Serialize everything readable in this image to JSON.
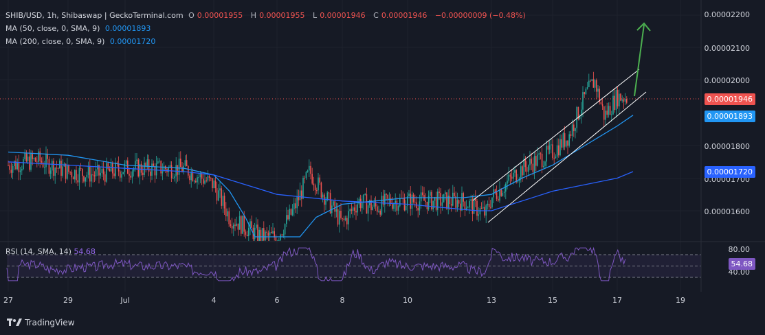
{
  "header": {
    "symbol": "SHIB/USD, 1h, Shibaswap | GeckoTerminal.com",
    "o_label": "O",
    "o_value": "0.00001955",
    "h_label": "H",
    "h_value": "0.00001955",
    "l_label": "L",
    "l_value": "0.00001946",
    "c_label": "C",
    "c_value": "0.00001946",
    "change": "−0.00000009 (−0.48%)"
  },
  "indicators": {
    "ma50_label": "MA (50, close, 0, SMA, 9)",
    "ma50_value": "0.00001893",
    "ma200_label": "MA (200, close, 0, SMA, 9)",
    "ma200_value": "0.00001720",
    "rsi_label": "RSI (14, SMA, 14)",
    "rsi_value": "54.68"
  },
  "price_tags": {
    "last": "0.00001946",
    "ma50": "0.00001893",
    "ma200": "0.00001720",
    "rsi": "54.68"
  },
  "colors": {
    "background": "#161a25",
    "up": "#26a69a",
    "down": "#ef5350",
    "ma50": "#2196f3",
    "ma200": "#2962ff",
    "rsi": "#7e57c2",
    "arrow": "#4caf50",
    "channel": "#ffffff"
  },
  "brand": "TradingView",
  "chart_data": {
    "type": "candlestick",
    "title": "SHIB/USD, 1h, Shibaswap | GeckoTerminal.com",
    "y_ticks": [
      "0.00002200",
      "0.00002100",
      "0.00002000",
      "0.00001800",
      "0.00001700",
      "0.00001600"
    ],
    "y_range": [
      1.58e-05,
      2.22e-05
    ],
    "x_ticks": [
      "27",
      "29",
      "Jul",
      "4",
      "6",
      "8",
      "10",
      "13",
      "15",
      "17",
      "19"
    ],
    "rsi_ticks": [
      "80.00",
      "40.00"
    ],
    "rsi_range": [
      20,
      90
    ],
    "rsi_bands": [
      70,
      50,
      30
    ],
    "price_anchors": [
      [
        "27",
        1.74e-05
      ],
      [
        "28",
        1.755e-05
      ],
      [
        "29",
        1.72e-05
      ],
      [
        "30",
        1.71e-05
      ],
      [
        "Jul",
        1.73e-05
      ],
      [
        "2",
        1.73e-05
      ],
      [
        "3",
        1.73e-05
      ],
      [
        "4",
        1.68e-05
      ],
      [
        "4.5",
        1.58e-05
      ],
      [
        "5",
        1.55e-05
      ],
      [
        "5.5",
        1.52e-05
      ],
      [
        "6",
        1.52e-05
      ],
      [
        "6.5",
        1.6e-05
      ],
      [
        "7",
        1.72e-05
      ],
      [
        "7.5",
        1.64e-05
      ],
      [
        "8",
        1.56e-05
      ],
      [
        "8.5",
        1.63e-05
      ],
      [
        "9",
        1.61e-05
      ],
      [
        "9.5",
        1.63e-05
      ],
      [
        "10",
        1.63e-05
      ],
      [
        "11",
        1.63e-05
      ],
      [
        "12",
        1.63e-05
      ],
      [
        "12.8",
        1.59e-05
      ],
      [
        "13",
        1.64e-05
      ],
      [
        "14",
        1.73e-05
      ],
      [
        "15",
        1.78e-05
      ],
      [
        "15.5",
        1.83e-05
      ],
      [
        "16",
        1.95e-05
      ],
      [
        "16.3",
        2e-05
      ],
      [
        "16.6",
        1.89e-05
      ],
      [
        "17",
        1.95e-05
      ],
      [
        "17.5",
        1.946e-05
      ]
    ],
    "ma50": [
      [
        "27",
        1.78e-05
      ],
      [
        "29",
        1.77e-05
      ],
      [
        "Jul",
        1.74e-05
      ],
      [
        "3",
        1.73e-05
      ],
      [
        "4",
        1.71e-05
      ],
      [
        "4.5",
        1.66e-05
      ],
      [
        "5",
        1.58e-05
      ],
      [
        "5.3",
        1.52e-05
      ],
      [
        "6.7",
        1.52e-05
      ],
      [
        "7.2",
        1.58e-05
      ],
      [
        "8",
        1.62e-05
      ],
      [
        "9",
        1.63e-05
      ],
      [
        "10",
        1.64e-05
      ],
      [
        "12",
        1.64e-05
      ],
      [
        "13",
        1.65e-05
      ],
      [
        "14",
        1.7e-05
      ],
      [
        "15",
        1.74e-05
      ],
      [
        "16",
        1.8e-05
      ],
      [
        "17",
        1.86e-05
      ],
      [
        "17.5",
        1.893e-05
      ]
    ],
    "ma200": [
      [
        "27",
        1.75e-05
      ],
      [
        "29",
        1.74e-05
      ],
      [
        "Jul",
        1.73e-05
      ],
      [
        "3",
        1.72e-05
      ],
      [
        "4",
        1.71e-05
      ],
      [
        "5",
        1.68e-05
      ],
      [
        "6",
        1.65e-05
      ],
      [
        "7",
        1.64e-05
      ],
      [
        "8",
        1.63e-05
      ],
      [
        "10",
        1.62e-05
      ],
      [
        "12.5",
        1.6e-05
      ],
      [
        "13",
        1.6e-05
      ],
      [
        "14",
        1.63e-05
      ],
      [
        "15",
        1.66e-05
      ],
      [
        "16",
        1.68e-05
      ],
      [
        "17",
        1.7e-05
      ],
      [
        "17.5",
        1.72e-05
      ]
    ]
  }
}
